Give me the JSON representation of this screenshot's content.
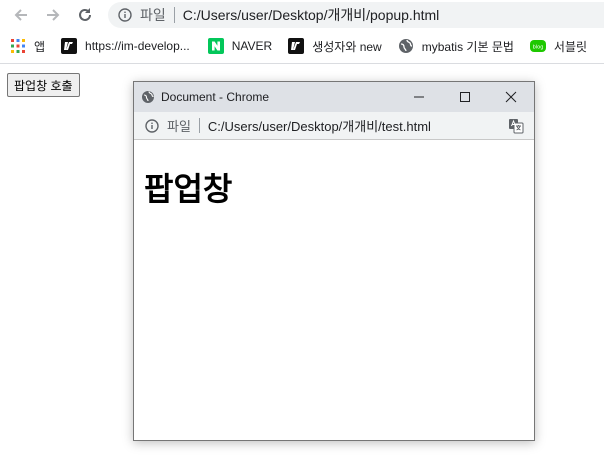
{
  "browser": {
    "omnibox": {
      "scheme_label": "파일",
      "url": "C:/Users/user/Desktop/개개비/popup.html"
    }
  },
  "bookmarks": [
    {
      "label": "앱",
      "icon": "apps-grid-icon"
    },
    {
      "label": "https://im-develop...",
      "icon": "site-logo-icon"
    },
    {
      "label": "NAVER",
      "icon": "naver-icon"
    },
    {
      "label": "생성자와 new",
      "icon": "site-logo-icon"
    },
    {
      "label": "mybatis 기본 문법",
      "icon": "globe-icon"
    },
    {
      "label": "서블릿",
      "icon": "blog-icon"
    }
  ],
  "page": {
    "button_label": "팝업창 호출"
  },
  "popup": {
    "title": "Document - Chrome",
    "address": {
      "scheme_label": "파일",
      "url": "C:/Users/user/Desktop/개개비/test.html"
    },
    "heading": "팝업창"
  },
  "colors": {
    "naver_green": "#03c75a",
    "blog_green": "#1ec800",
    "omnibox_bg": "#f1f3f4",
    "titlebar_bg": "#dee1e6"
  }
}
